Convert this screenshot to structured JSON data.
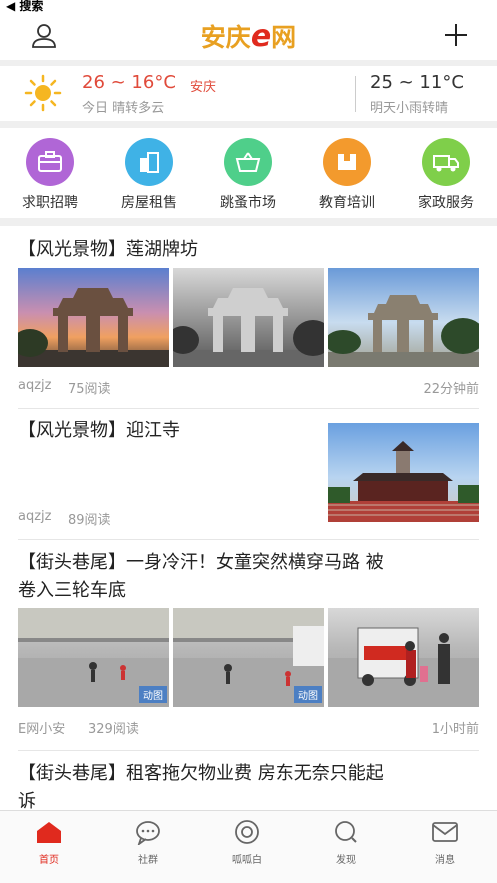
{
  "status": {
    "back_label": "◀ 搜索"
  },
  "header": {
    "logo_main": "安庆",
    "logo_e": "e",
    "logo_tail": "网"
  },
  "weather": {
    "today_temp": "26 ~ 16°C",
    "city": "安庆",
    "today_cond": "今日 晴转多云",
    "tomorrow_temp": "25 ~ 11°C",
    "tomorrow_cond": "明天小雨转晴"
  },
  "categories": [
    {
      "label": "求职招聘",
      "icon": "briefcase-icon",
      "color": "#b066d6"
    },
    {
      "label": "房屋租售",
      "icon": "building-icon",
      "color": "#3fb2e6"
    },
    {
      "label": "跳蚤市场",
      "icon": "basket-icon",
      "color": "#4fcf8a"
    },
    {
      "label": "教育培训",
      "icon": "book-icon",
      "color": "#f39a2d"
    },
    {
      "label": "家政服务",
      "icon": "truck-icon",
      "color": "#7fcf4a"
    }
  ],
  "articles": [
    {
      "title": "【风光景物】莲湖牌坊",
      "author": "aqzjz",
      "reads": "75阅读",
      "time": "22分钟前"
    },
    {
      "title": "【风光景物】迎江寺",
      "author": "aqzjz",
      "reads": "89阅读"
    },
    {
      "title_line1": "【街头巷尾】一身冷汗！女童突然横穿马路 被",
      "title_line2": "卷入三轮车底",
      "author": "E网小安",
      "reads": "329阅读",
      "time": "1小时前",
      "badge": "动图"
    },
    {
      "title_line1": "【街头巷尾】租客拖欠物业费 房东无奈只能起",
      "title_line2": "诉"
    }
  ],
  "tabs": [
    {
      "label": "首页",
      "icon": "home-icon"
    },
    {
      "label": "社群",
      "icon": "chat-icon"
    },
    {
      "label": "呱呱白",
      "icon": "circle-icon"
    },
    {
      "label": "发现",
      "icon": "search-icon"
    },
    {
      "label": "消息",
      "icon": "mail-icon"
    }
  ],
  "colors": {
    "accent": "#e02a1e",
    "logo_orange": "#e8a021",
    "temp_red": "#e04a3a"
  }
}
